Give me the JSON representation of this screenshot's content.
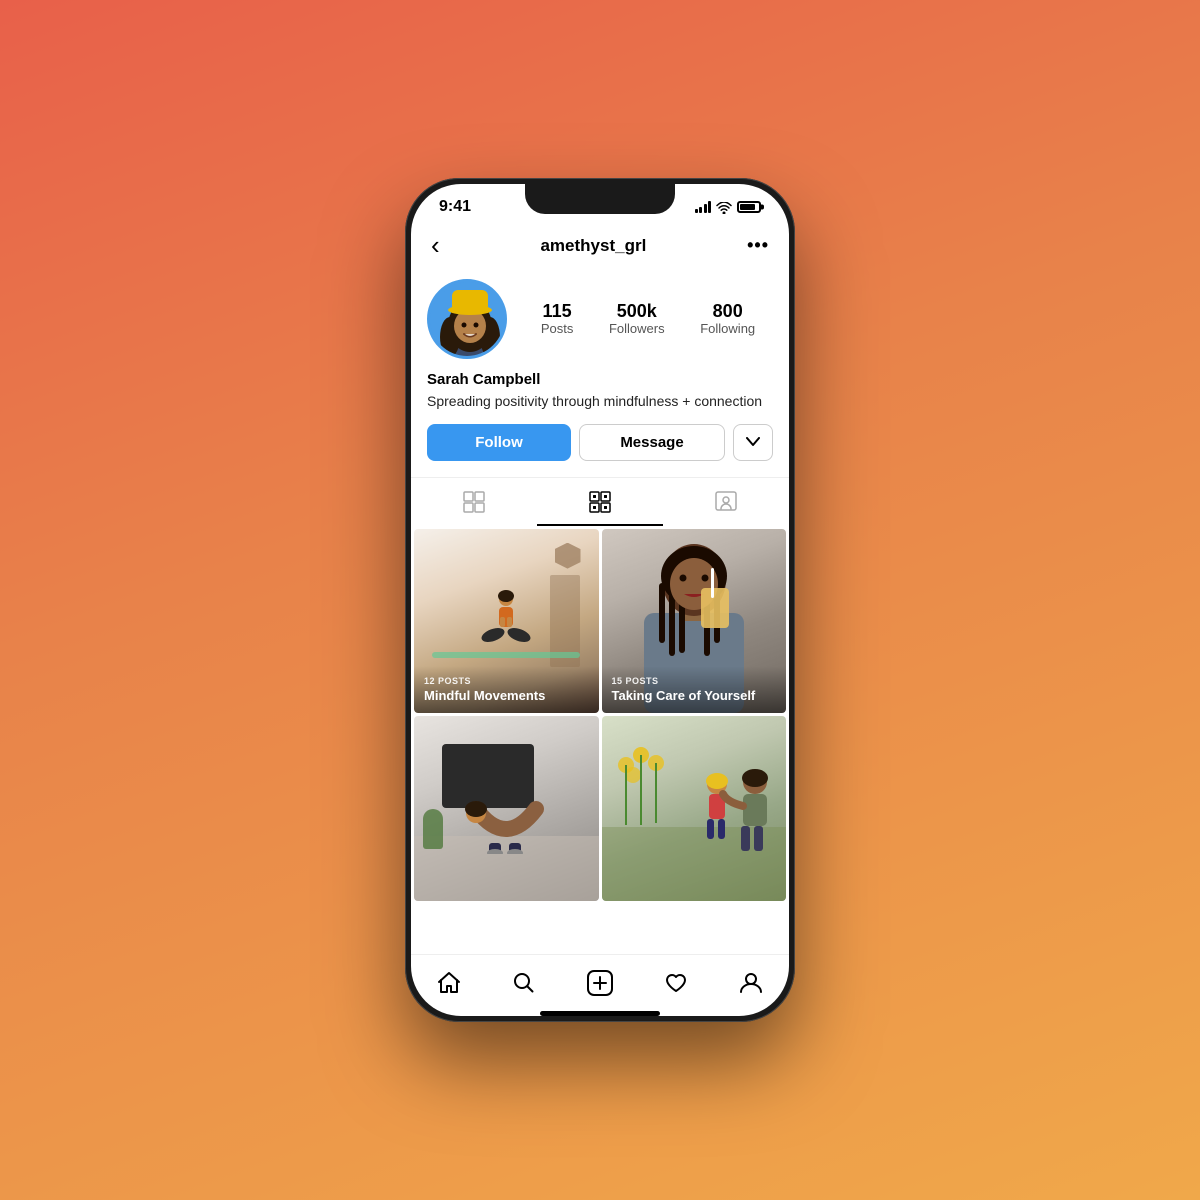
{
  "background": {
    "gradient_start": "#e8604a",
    "gradient_end": "#f0a84a"
  },
  "status_bar": {
    "time": "9:41"
  },
  "nav": {
    "title": "amethyst_grl",
    "back_label": "‹",
    "more_label": "···"
  },
  "profile": {
    "username": "amethyst_grl",
    "name": "Sarah Campbell",
    "bio": "Spreading positivity through mindfulness + connection",
    "stats": {
      "posts": {
        "count": "115",
        "label": "Posts"
      },
      "followers": {
        "count": "500k",
        "label": "Followers"
      },
      "following": {
        "count": "800",
        "label": "Following"
      }
    }
  },
  "buttons": {
    "follow": "Follow",
    "message": "Message",
    "dropdown": "▾"
  },
  "tabs": {
    "grid_icon": "⊞",
    "reels_icon": "▣",
    "tagged_icon": "◻"
  },
  "posts": [
    {
      "id": "mindful-movements",
      "post_count": "12 POSTS",
      "title": "Mindful Movements",
      "type": "yoga"
    },
    {
      "id": "taking-care",
      "post_count": "15 POSTS",
      "title": "Taking Care of Yourself",
      "type": "drink"
    },
    {
      "id": "stretch",
      "post_count": "",
      "title": "",
      "type": "stretch"
    },
    {
      "id": "garden",
      "post_count": "",
      "title": "",
      "type": "garden"
    }
  ],
  "bottom_nav": {
    "home": "⌂",
    "search": "⌕",
    "add": "⊕",
    "heart": "♡",
    "profile": "◯"
  }
}
